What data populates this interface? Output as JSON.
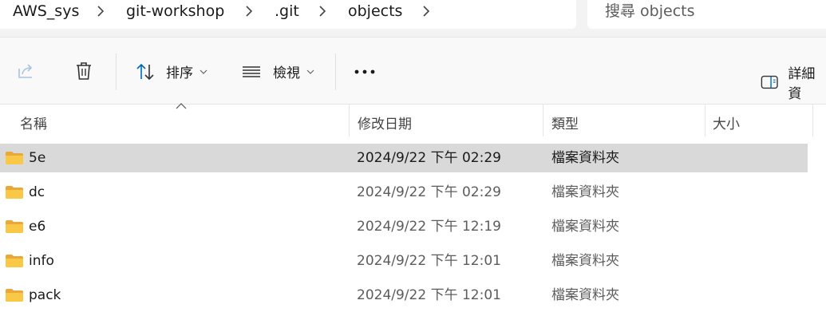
{
  "breadcrumb": {
    "items": [
      "AWS_sys",
      "git-workshop",
      ".git",
      "objects"
    ]
  },
  "search": {
    "placeholder": "搜尋 objects"
  },
  "toolbar": {
    "sort_label": "排序",
    "view_label": "檢視",
    "more_label": "•••",
    "details_label": "詳細資"
  },
  "columns": {
    "name": "名稱",
    "date": "修改日期",
    "type": "類型",
    "size": "大小"
  },
  "files": [
    {
      "name": "5e",
      "date": "2024/9/22 下午 02:29",
      "type": "檔案資料夾",
      "selected": true
    },
    {
      "name": "dc",
      "date": "2024/9/22 下午 02:29",
      "type": "檔案資料夾",
      "selected": false
    },
    {
      "name": "e6",
      "date": "2024/9/22 下午 12:19",
      "type": "檔案資料夾",
      "selected": false
    },
    {
      "name": "info",
      "date": "2024/9/22 下午 12:01",
      "type": "檔案資料夾",
      "selected": false
    },
    {
      "name": "pack",
      "date": "2024/9/22 下午 12:01",
      "type": "檔案資料夾",
      "selected": false
    }
  ],
  "colors": {
    "selection": "#d9d9d9",
    "folder": "#f8c846",
    "accent": "#0067c0"
  }
}
